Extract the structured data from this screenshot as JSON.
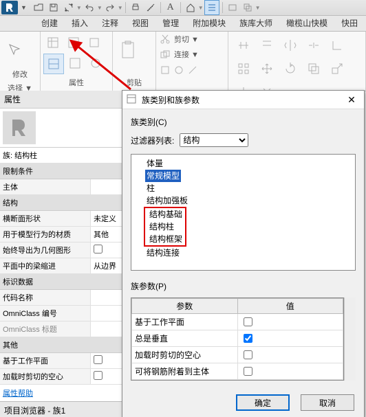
{
  "qat": {
    "tooltip": "Revit"
  },
  "tabs": [
    "创建",
    "插入",
    "注释",
    "视图",
    "管理",
    "附加模块",
    "族库大师",
    "橄榄山快模",
    "快田"
  ],
  "ribbon_groups": [
    {
      "label": "修改"
    },
    {
      "label": "选择 ▼"
    },
    {
      "label": "属性"
    },
    {
      "label": "剪贴"
    },
    {
      "label": "剪切 ▼"
    },
    {
      "label": "连接 ▼"
    }
  ],
  "props": {
    "title": "属性",
    "family_label": "族: 结构柱",
    "sections": [
      {
        "title": "限制条件",
        "rows": [
          {
            "k": "主体",
            "v": ""
          }
        ]
      },
      {
        "title": "结构",
        "rows": [
          {
            "k": "横断面形状",
            "v": "未定义"
          },
          {
            "k": "用于模型行为的材质",
            "v": "其他"
          },
          {
            "k": "始终导出为几何图形",
            "v": "",
            "chk": false
          },
          {
            "k": "平面中的梁缩进",
            "v": "从边界"
          }
        ]
      },
      {
        "title": "标识数据",
        "rows": [
          {
            "k": "代码名称",
            "v": ""
          },
          {
            "k": "OmniClass 编号",
            "v": ""
          },
          {
            "k": "OmniClass 标题",
            "v": "",
            "grey": true
          }
        ]
      },
      {
        "title": "其他",
        "rows": [
          {
            "k": "基于工作平面",
            "v": "",
            "chk": false
          },
          {
            "k": "加载时剪切的空心",
            "v": "",
            "chk": false
          }
        ]
      }
    ],
    "help": "属性帮助",
    "browser": "项目浏览器 - 族1"
  },
  "dialog": {
    "title": "族类别和族参数",
    "cat_label": "族类别(C)",
    "filter_label": "过滤器列表:",
    "filter_value": "结构",
    "tree": [
      {
        "t": "体量"
      },
      {
        "t": "常规模型",
        "sel": true
      },
      {
        "t": "柱"
      },
      {
        "t": "结构加强板"
      },
      {
        "t": "结构基础",
        "red": true
      },
      {
        "t": "结构柱",
        "red": true
      },
      {
        "t": "结构框架",
        "red": true
      },
      {
        "t": "结构连接"
      }
    ],
    "param_label": "族参数(P)",
    "param_headers": [
      "参数",
      "值"
    ],
    "param_rows": [
      {
        "k": "基于工作平面",
        "chk": false
      },
      {
        "k": "总是垂直",
        "chk": true
      },
      {
        "k": "加载时剪切的空心",
        "chk": false
      },
      {
        "k": "可将钢筋附着到主体",
        "chk": false
      }
    ],
    "ok": "确定",
    "cancel": "取消"
  }
}
